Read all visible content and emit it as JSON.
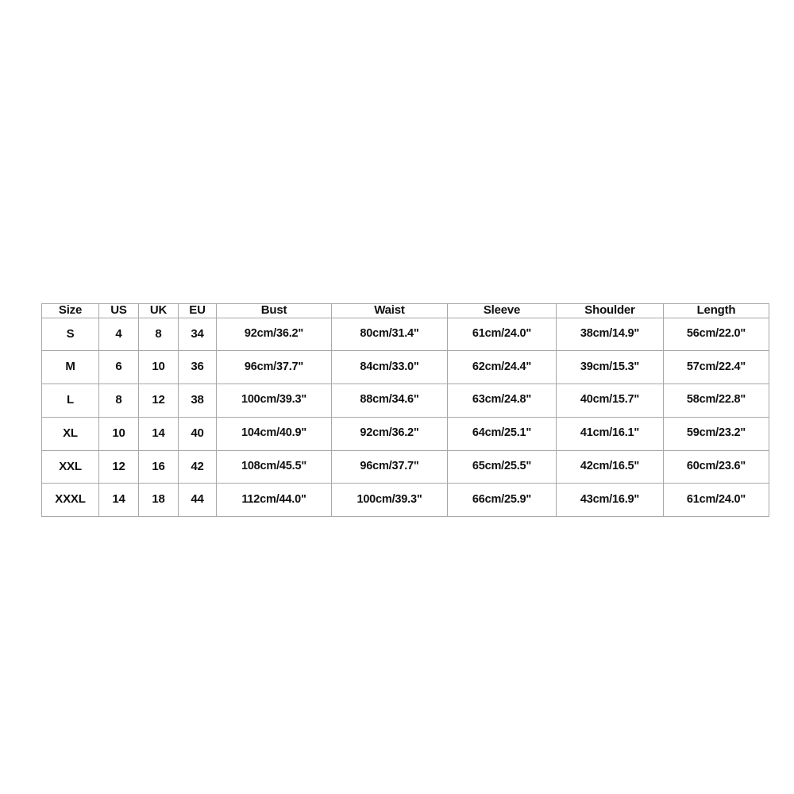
{
  "page": {
    "background_color": "#ffffff",
    "border_color": "#a8a8a8",
    "text_color": "#101010"
  },
  "size_chart": {
    "columns": [
      {
        "key": "size",
        "label": "Size"
      },
      {
        "key": "us",
        "label": "US"
      },
      {
        "key": "uk",
        "label": "UK"
      },
      {
        "key": "eu",
        "label": "EU"
      },
      {
        "key": "bust",
        "label": "Bust"
      },
      {
        "key": "waist",
        "label": "Waist"
      },
      {
        "key": "sleeve",
        "label": "Sleeve"
      },
      {
        "key": "shoulder",
        "label": "Shoulder"
      },
      {
        "key": "length",
        "label": "Length"
      }
    ],
    "rows": [
      {
        "size": "S",
        "us": "4",
        "uk": "8",
        "eu": "34",
        "bust": "92cm/36.2\"",
        "waist": "80cm/31.4\"",
        "sleeve": "61cm/24.0\"",
        "shoulder": "38cm/14.9\"",
        "length": "56cm/22.0\""
      },
      {
        "size": "M",
        "us": "6",
        "uk": "10",
        "eu": "36",
        "bust": "96cm/37.7\"",
        "waist": "84cm/33.0\"",
        "sleeve": "62cm/24.4\"",
        "shoulder": "39cm/15.3\"",
        "length": "57cm/22.4\""
      },
      {
        "size": "L",
        "us": "8",
        "uk": "12",
        "eu": "38",
        "bust": "100cm/39.3\"",
        "waist": "88cm/34.6\"",
        "sleeve": "63cm/24.8\"",
        "shoulder": "40cm/15.7\"",
        "length": "58cm/22.8\""
      },
      {
        "size": "XL",
        "us": "10",
        "uk": "14",
        "eu": "40",
        "bust": "104cm/40.9\"",
        "waist": "92cm/36.2\"",
        "sleeve": "64cm/25.1\"",
        "shoulder": "41cm/16.1\"",
        "length": "59cm/23.2\""
      },
      {
        "size": "XXL",
        "us": "12",
        "uk": "16",
        "eu": "42",
        "bust": "108cm/45.5\"",
        "waist": "96cm/37.7\"",
        "sleeve": "65cm/25.5\"",
        "shoulder": "42cm/16.5\"",
        "length": "60cm/23.6\""
      },
      {
        "size": "XXXL",
        "us": "14",
        "uk": "18",
        "eu": "44",
        "bust": "112cm/44.0\"",
        "waist": "100cm/39.3\"",
        "sleeve": "66cm/25.9\"",
        "shoulder": "43cm/16.9\"",
        "length": "61cm/24.0\""
      }
    ]
  }
}
